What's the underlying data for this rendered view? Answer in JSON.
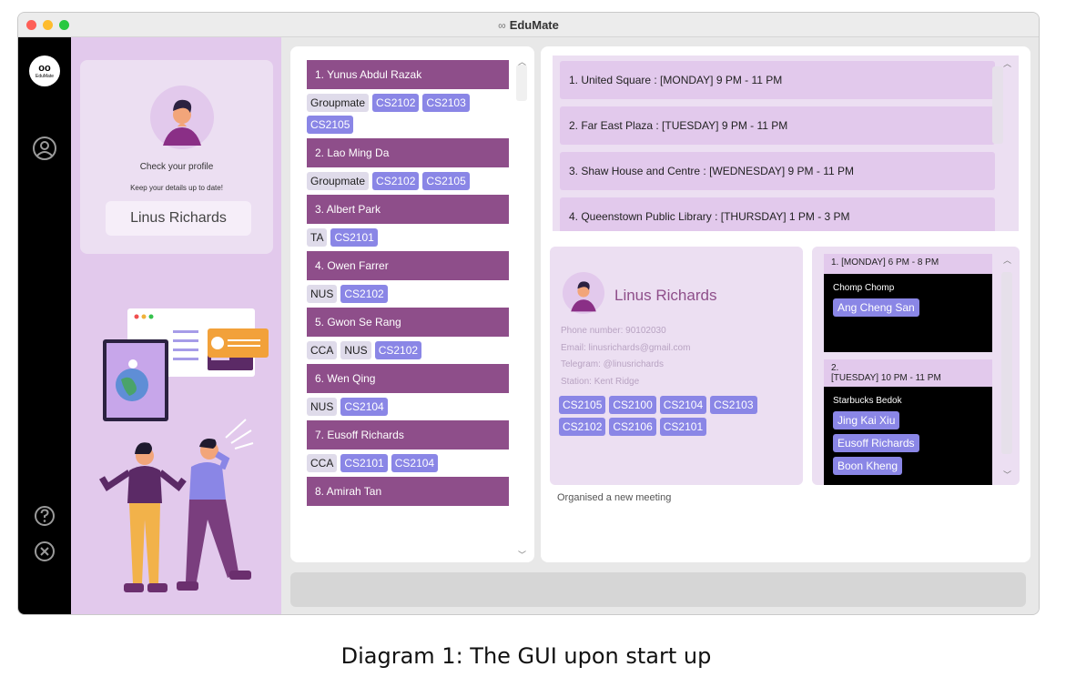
{
  "window": {
    "title": "EduMate",
    "title_icon": "infinity-icon"
  },
  "sidebar": {
    "logo_text": "oo",
    "logo_sub": "EduMate",
    "icons": [
      "logo-icon",
      "user-profile-icon",
      "help-icon",
      "close-circle-icon"
    ]
  },
  "profile_card": {
    "title": "Check your profile",
    "subtitle": "Keep your details up to date!",
    "name": "Linus Richards"
  },
  "contacts": [
    {
      "label": "1.   Yunus Abdul Razak",
      "tags": [
        {
          "t": "Groupmate",
          "k": "grey"
        },
        {
          "t": "CS2102",
          "k": "blue"
        },
        {
          "t": "CS2103",
          "k": "blue"
        },
        {
          "t": "CS2105",
          "k": "blue"
        }
      ]
    },
    {
      "label": "2.   Lao Ming Da",
      "tags": [
        {
          "t": "Groupmate",
          "k": "grey"
        },
        {
          "t": "CS2102",
          "k": "blue"
        },
        {
          "t": "CS2105",
          "k": "blue"
        }
      ]
    },
    {
      "label": "3.   Albert Park",
      "tags": [
        {
          "t": "TA",
          "k": "grey"
        },
        {
          "t": "CS2101",
          "k": "blue"
        }
      ]
    },
    {
      "label": "4.   Owen Farrer",
      "tags": [
        {
          "t": "NUS",
          "k": "grey"
        },
        {
          "t": "CS2102",
          "k": "blue"
        }
      ]
    },
    {
      "label": "5.   Gwon Se Rang",
      "tags": [
        {
          "t": "CCA",
          "k": "grey"
        },
        {
          "t": "NUS",
          "k": "grey"
        },
        {
          "t": "CS2102",
          "k": "blue"
        }
      ]
    },
    {
      "label": "6.   Wen Qing",
      "tags": [
        {
          "t": "NUS",
          "k": "grey"
        },
        {
          "t": "CS2104",
          "k": "blue"
        }
      ]
    },
    {
      "label": "7.   Eusoff Richards",
      "tags": [
        {
          "t": "CCA",
          "k": "grey"
        },
        {
          "t": "CS2101",
          "k": "blue"
        },
        {
          "t": "CS2104",
          "k": "blue"
        }
      ]
    },
    {
      "label": "8.   Amirah Tan",
      "tags": []
    }
  ],
  "locations": [
    "1.   United Square : [MONDAY] 9 PM - 11 PM",
    "2.   Far East Plaza : [TUESDAY] 9 PM - 11 PM",
    "3.   Shaw House and Centre : [WEDNESDAY] 9 PM - 11 PM",
    "4.   Queenstown Public Library : [THURSDAY] 1 PM - 3 PM"
  ],
  "user_profile": {
    "name": "Linus Richards",
    "phone": "Phone number: 90102030",
    "email": "Email: linusrichards@gmail.com",
    "telegram": "Telegram: @linusrichards",
    "station": "Station: Kent Ridge",
    "modules": [
      "CS2105",
      "CS2100",
      "CS2104",
      "CS2103",
      "CS2102",
      "CS2106",
      "CS2101"
    ]
  },
  "meetings": [
    {
      "header": "1. [MONDAY] 6 PM - 8 PM",
      "location": "Chomp Chomp",
      "people": [
        "Ang Cheng San"
      ]
    },
    {
      "header": "2.\n[TUESDAY] 10 PM - 11 PM",
      "location": "Starbucks Bedok",
      "people": [
        "Jing Kai Xiu",
        "Eusoff Richards",
        "Boon Kheng"
      ]
    }
  ],
  "status_message": "Organised a new meeting",
  "command_box": {
    "value": ""
  },
  "caption": "Diagram 1: The GUI upon start up",
  "colors": {
    "contact_header": "#8e4e8a",
    "tag_blue": "#8a86e6",
    "panel_lavender": "#ecdff2",
    "sidebar": "#000000"
  }
}
